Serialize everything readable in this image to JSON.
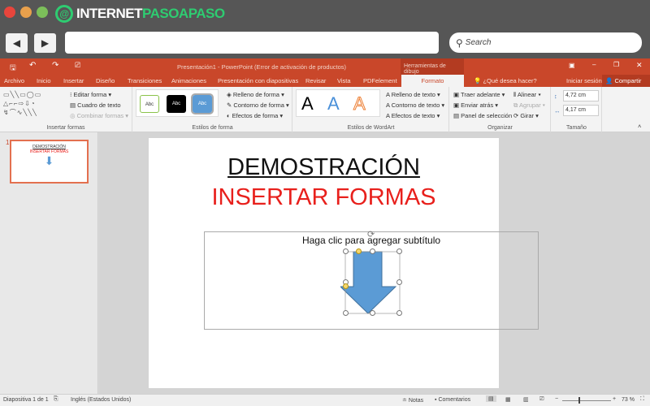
{
  "browser": {
    "logo_text_white": "INTERNET",
    "logo_text_green": "PASOAPASO",
    "search_placeholder": "Search",
    "back": "◀",
    "forward": "▶"
  },
  "window": {
    "title": "Presentación1 - PowerPoint (Error de activación de productos)",
    "context_tab": "Herramientas de dibujo",
    "signin": "Iniciar sesión",
    "share": "Compartir",
    "tell_me": "¿Qué desea hacer?"
  },
  "tabs": [
    "Archivo",
    "Inicio",
    "Insertar",
    "Diseño",
    "Transiciones",
    "Animaciones",
    "Presentación con diapositivas",
    "Revisar",
    "Vista",
    "PDFelement",
    "Formato"
  ],
  "ribbon": {
    "insert_shapes": {
      "label": "Insertar formas",
      "edit_shape": "Editar forma",
      "text_box": "Cuadro de texto",
      "merge_shapes": "Combinar formas"
    },
    "shape_styles": {
      "label": "Estilos de forma",
      "presets": [
        "Abc",
        "Abc",
        "Abc"
      ],
      "fill": "Relleno de forma",
      "outline": "Contorno de forma",
      "effects": "Efectos de forma"
    },
    "wordart": {
      "label": "Estilos de WordArt",
      "letters": [
        "A",
        "A",
        "A"
      ],
      "fill": "Relleno de texto",
      "outline": "Contorno de texto",
      "effects": "Efectos de texto"
    },
    "arrange": {
      "label": "Organizar",
      "bring_forward": "Traer adelante",
      "send_backward": "Enviar atrás",
      "selection_pane": "Panel de selección",
      "align": "Alinear",
      "group": "Agrupar",
      "rotate": "Girar"
    },
    "size": {
      "label": "Tamaño",
      "height": "4,72 cm",
      "width": "4,17 cm"
    }
  },
  "thumbnail": {
    "number": "1",
    "title": "DEMOSTRACIÓN",
    "subtitle": "INSERTAR FORMAS"
  },
  "slide": {
    "title": "DEMOSTRACIÓN",
    "subtitle": "INSERTAR FORMAS",
    "placeholder": "Haga clic para agregar subtítulo"
  },
  "status": {
    "slide": "Diapositiva 1 de 1",
    "language": "Inglés (Estados Unidos)",
    "notes": "Notas",
    "comments": "Comentarios",
    "zoom": "73 %",
    "zoom_fraction": 0.73
  },
  "colors": {
    "accent": "#c9472a",
    "red_text": "#e8201c",
    "arrow": "#5b9bd5"
  }
}
